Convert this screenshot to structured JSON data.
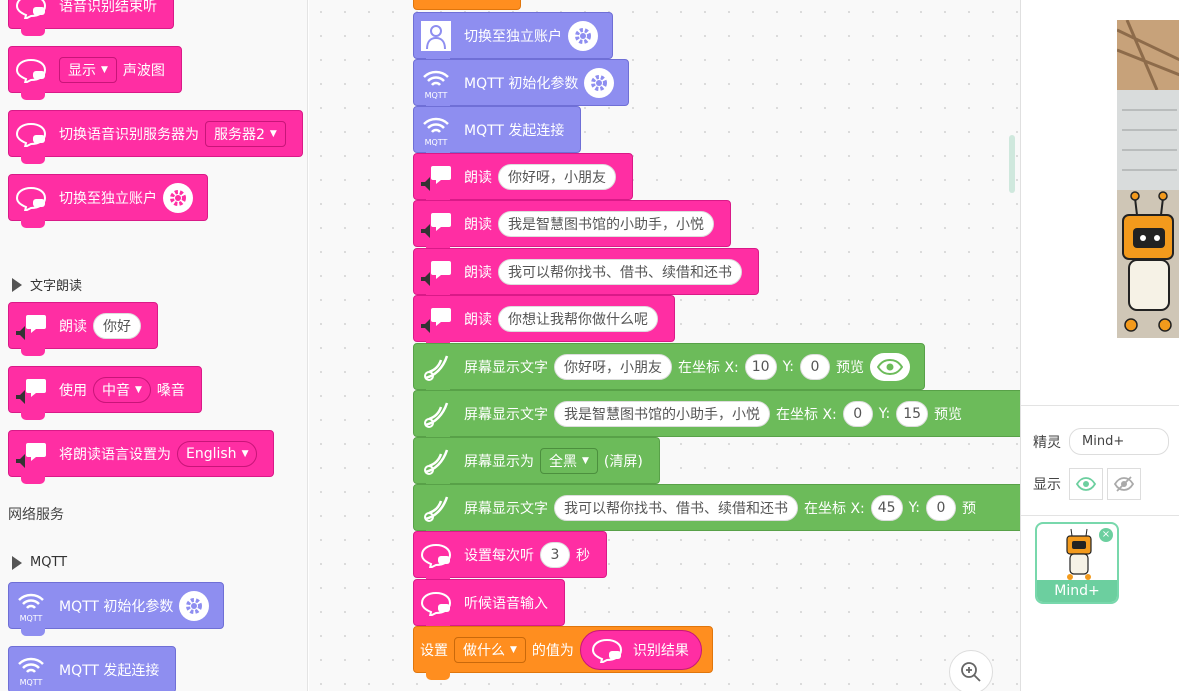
{
  "palette": {
    "cut_block": "语音识别结束听",
    "show_label": "显示",
    "waveform_label": "声波图",
    "switch_service_label": "切换语音识别服务器为",
    "server_option": "服务器2",
    "switch_account_label": "切换至独立账户",
    "tts_category": "文字朗读",
    "read_label": "朗读",
    "read_value": "你好",
    "use_label": "使用",
    "voice_option": "中音",
    "voice_suffix": "嗓音",
    "set_language_label": "将朗读语言设置为",
    "language_option": "English",
    "network_section": "网络服务",
    "mqtt_category": "MQTT",
    "mqtt_init_label": "MQTT 初始化参数",
    "mqtt_connect_label": "MQTT 发起连接"
  },
  "workspace": {
    "b_switch": "切换至独立账户",
    "b_mqtt_init": "MQTT 初始化参数",
    "b_mqtt_connect": "MQTT 发起连接",
    "read_label": "朗读",
    "read1": "你好呀，小朋友",
    "read2": "我是智慧图书馆的小助手，小悦",
    "read3": "我可以帮你找书、借书、续借和还书",
    "read4": "你想让我帮你做什么呢",
    "screen_text_label": "屏幕显示文字",
    "at_coord": "在坐标 X:",
    "y_label": "Y:",
    "preview": "预览",
    "preview_cut": "预览",
    "text1": "你好呀，小朋友",
    "t1x": "10",
    "t1y": "0",
    "text2": "我是智慧图书馆的小助手，小悦",
    "t2x": "0",
    "t2y": "15",
    "screen_fill_label": "屏幕显示为",
    "fill_option": "全黑",
    "fill_suffix": "(清屏)",
    "text3": "我可以帮你找书、借书、续借和还书",
    "t3x": "45",
    "t3y": "0",
    "t3_cut": "预",
    "listen_each_label": "设置每次听",
    "listen_seconds": "3",
    "seconds_unit": "秒",
    "listen_input_label": "听候语音输入",
    "set_label": "设置",
    "var_option": "做什么",
    "value_label": "的值为",
    "result_label": "识别结果"
  },
  "stage": {
    "sprite_label": "精灵",
    "sprite_name": "Mind+",
    "show_label": "显示",
    "sprite_card_name": "Mind+"
  },
  "colors": {
    "speech_pink": "#ff2ea3",
    "mqtt_purple": "#8e8ef0",
    "display_green": "#6cbb5a",
    "variable_orange": "#ff8e1f",
    "accent_teal": "#6ccf9f"
  }
}
